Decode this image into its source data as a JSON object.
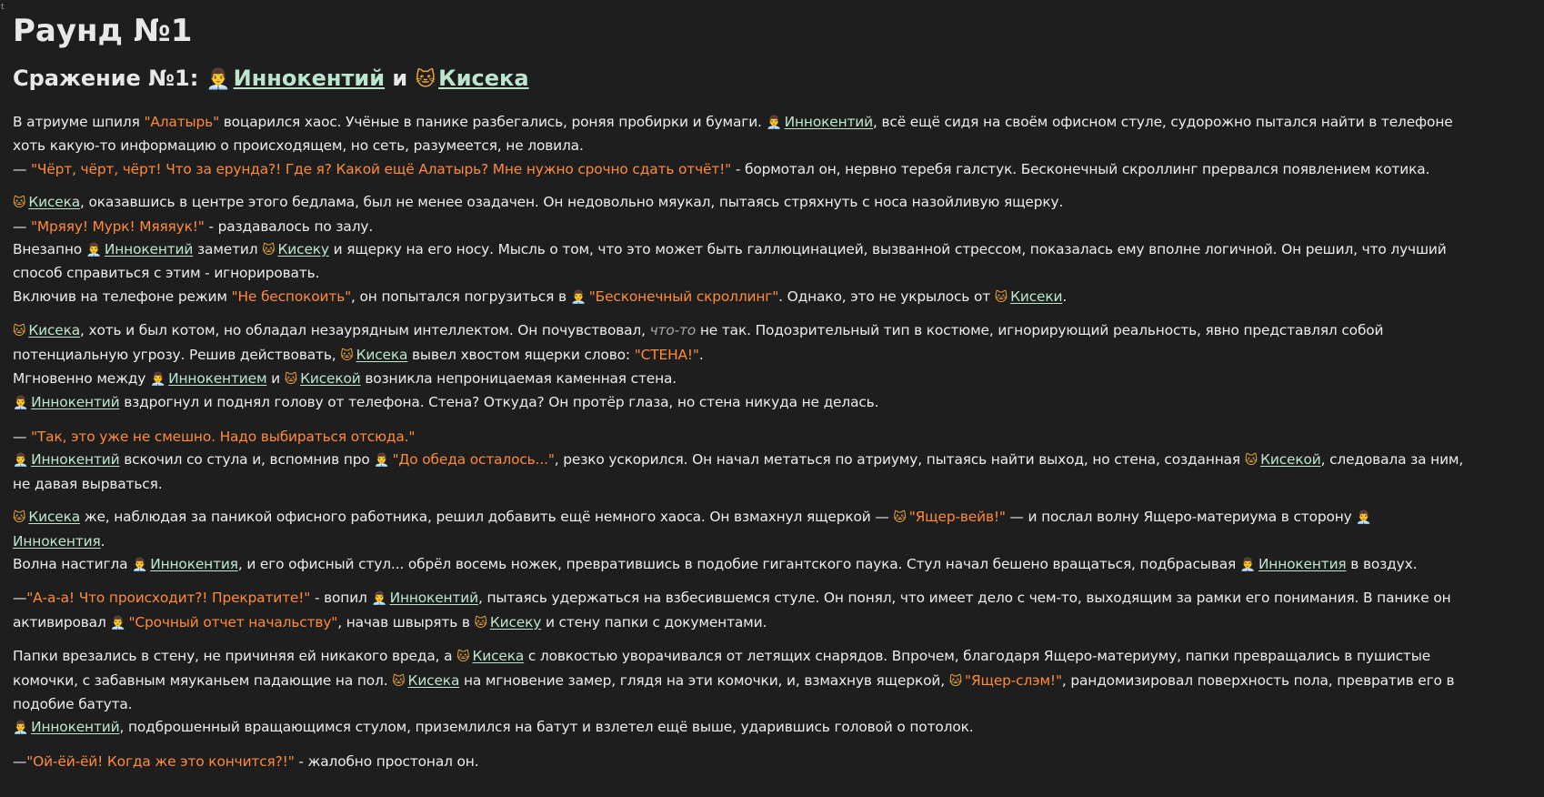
{
  "corner_mark": "t",
  "icons": {
    "cat": "🐱",
    "man": "👨‍💼"
  },
  "title": "Раунд №1",
  "battle": {
    "prefix": "Сражение №1: ",
    "fighter1": "Иннокентий",
    "and": " и ",
    "fighter2": "Кисека"
  },
  "paragraphs": [
    {
      "lines": [
        [
          {
            "t": "text",
            "v": "В атриуме шпиля "
          },
          {
            "t": "q",
            "v": "\"Алатырь\""
          },
          {
            "t": "text",
            "v": " воцарился хаос. Учёные в панике разбегались, роняя пробирки и бумаги. "
          },
          {
            "t": "man"
          },
          {
            "t": "link",
            "v": "Иннокентий"
          },
          {
            "t": "text",
            "v": ", всё ещё сидя на своём офисном стуле, судорожно пытался найти в телефоне"
          }
        ],
        [
          {
            "t": "text",
            "v": "хоть какую-то информацию о происходящем, но сеть, разумеется, не ловила."
          }
        ],
        [
          {
            "t": "text",
            "v": "— "
          },
          {
            "t": "q",
            "v": "\"Чёрт, чёрт, чёрт! Что за ерунда?! Где я? Какой ещё Алатырь? Мне нужно срочно сдать отчёт!\""
          },
          {
            "t": "text",
            "v": " - бормотал он, нервно теребя галстук. Бесконечный скроллинг прервался появлением котика."
          }
        ]
      ]
    },
    {
      "lines": [
        [
          {
            "t": "cat"
          },
          {
            "t": "link",
            "v": "Кисека"
          },
          {
            "t": "text",
            "v": ", оказавшись в центре этого бедлама, был не менее озадачен. Он недовольно мяукал, пытаясь стряхнуть с носа назойливую ящерку."
          }
        ],
        [
          {
            "t": "text",
            "v": "— "
          },
          {
            "t": "q",
            "v": "\"Мряяу! Мурк! Мяяяук!\""
          },
          {
            "t": "text",
            "v": " - раздавалось по залу."
          }
        ],
        [
          {
            "t": "text",
            "v": "Внезапно "
          },
          {
            "t": "man"
          },
          {
            "t": "link",
            "v": "Иннокентий"
          },
          {
            "t": "text",
            "v": " заметил "
          },
          {
            "t": "cat"
          },
          {
            "t": "link",
            "v": "Кисеку"
          },
          {
            "t": "text",
            "v": " и ящерку на его носу. Мысль о том, что это может быть галлюцинацией, вызванной стрессом, показалась ему вполне логичной. Он решил, что лучший"
          }
        ],
        [
          {
            "t": "text",
            "v": "способ справиться с этим - игнорировать."
          }
        ],
        [
          {
            "t": "text",
            "v": "Включив на телефоне режим "
          },
          {
            "t": "q",
            "v": "\"Не беспокоить\""
          },
          {
            "t": "text",
            "v": ", он попытался погрузиться в "
          },
          {
            "t": "man"
          },
          {
            "t": "q",
            "v": "\"Бесконечный скроллинг\""
          },
          {
            "t": "text",
            "v": ". Однако, это не укрылось от "
          },
          {
            "t": "cat"
          },
          {
            "t": "link",
            "v": "Кисеки"
          },
          {
            "t": "text",
            "v": "."
          }
        ]
      ]
    },
    {
      "lines": [
        [
          {
            "t": "cat"
          },
          {
            "t": "link",
            "v": "Кисека"
          },
          {
            "t": "text",
            "v": ", хоть и был котом, но обладал незаурядным интеллектом. Он почувствовал, "
          },
          {
            "t": "em",
            "v": "что-то"
          },
          {
            "t": "text",
            "v": " не так. Подозрительный тип в костюме, игнорирующий реальность, явно представлял собой"
          }
        ],
        [
          {
            "t": "text",
            "v": "потенциальную угрозу. Решив действовать, "
          },
          {
            "t": "cat"
          },
          {
            "t": "link",
            "v": "Кисека"
          },
          {
            "t": "text",
            "v": " вывел хвостом ящерки слово: "
          },
          {
            "t": "q",
            "v": "\"СТЕНА!\""
          },
          {
            "t": "text",
            "v": "."
          }
        ],
        [
          {
            "t": "text",
            "v": "Мгновенно между "
          },
          {
            "t": "man"
          },
          {
            "t": "link",
            "v": "Иннокентием"
          },
          {
            "t": "text",
            "v": " и "
          },
          {
            "t": "cat"
          },
          {
            "t": "link",
            "v": "Кисекой"
          },
          {
            "t": "text",
            "v": " возникла непроницаемая каменная стена."
          }
        ],
        [
          {
            "t": "man"
          },
          {
            "t": "link",
            "v": "Иннокентий"
          },
          {
            "t": "text",
            "v": " вздрогнул и поднял голову от телефона. Стена? Откуда? Он протёр глаза, но стена никуда не делась."
          }
        ]
      ]
    },
    {
      "lines": [
        [
          {
            "t": "text",
            "v": "— "
          },
          {
            "t": "q",
            "v": "\"Так, это уже не смешно. Надо выбираться отсюда.\""
          }
        ],
        [
          {
            "t": "man"
          },
          {
            "t": "link",
            "v": "Иннокентий"
          },
          {
            "t": "text",
            "v": " вскочил со стула и, вспомнив про "
          },
          {
            "t": "man"
          },
          {
            "t": "q",
            "v": "\"До обеда осталось...\""
          },
          {
            "t": "text",
            "v": ", резко ускорился. Он начал метаться по атриуму, пытаясь найти выход, но стена, созданная "
          },
          {
            "t": "cat"
          },
          {
            "t": "link",
            "v": "Кисекой"
          },
          {
            "t": "text",
            "v": ", следовала за ним,"
          }
        ],
        [
          {
            "t": "text",
            "v": "не давая вырваться."
          }
        ]
      ]
    },
    {
      "lines": [
        [
          {
            "t": "cat"
          },
          {
            "t": "link",
            "v": "Кисека"
          },
          {
            "t": "text",
            "v": " же, наблюдая за паникой офисного работника, решил добавить ещё немного хаоса. Он взмахнул ящеркой — "
          },
          {
            "t": "cat"
          },
          {
            "t": "q",
            "v": "\"Ящер-вейв!\""
          },
          {
            "t": "text",
            "v": " — и послал волну Ящеро-материума в сторону "
          },
          {
            "t": "man"
          }
        ],
        [
          {
            "t": "link",
            "v": "Иннокентия"
          },
          {
            "t": "text",
            "v": "."
          }
        ],
        [
          {
            "t": "text",
            "v": "Волна настигла "
          },
          {
            "t": "man"
          },
          {
            "t": "link",
            "v": "Иннокентия"
          },
          {
            "t": "text",
            "v": ", и его офисный стул... обрёл восемь ножек, превратившись в подобие гигантского паука. Стул начал бешено вращаться, подбрасывая "
          },
          {
            "t": "man"
          },
          {
            "t": "link",
            "v": "Иннокентия"
          },
          {
            "t": "text",
            "v": " в воздух."
          }
        ]
      ]
    },
    {
      "lines": [
        [
          {
            "t": "text",
            "v": "—"
          },
          {
            "t": "q",
            "v": "\"А-а-а! Что происходит?! Прекратите!\""
          },
          {
            "t": "text",
            "v": " - вопил "
          },
          {
            "t": "man"
          },
          {
            "t": "link",
            "v": "Иннокентий"
          },
          {
            "t": "text",
            "v": ", пытаясь удержаться на взбесившемся стуле. Он понял, что имеет дело с чем-то, выходящим за рамки его понимания. В панике он"
          }
        ],
        [
          {
            "t": "text",
            "v": "активировал "
          },
          {
            "t": "man"
          },
          {
            "t": "q",
            "v": "\"Срочный отчет начальству\""
          },
          {
            "t": "text",
            "v": ", начав швырять в "
          },
          {
            "t": "cat"
          },
          {
            "t": "link",
            "v": "Кисеку"
          },
          {
            "t": "text",
            "v": " и стену папки с документами."
          }
        ]
      ]
    },
    {
      "lines": [
        [
          {
            "t": "text",
            "v": "Папки врезались в стену, не причиняя ей никакого вреда, а "
          },
          {
            "t": "cat"
          },
          {
            "t": "link",
            "v": "Кисека"
          },
          {
            "t": "text",
            "v": " с ловкостью уворачивался от летящих снарядов. Впрочем, благодаря Ящеро-материуму, папки превращались в пушистые"
          }
        ],
        [
          {
            "t": "text",
            "v": "комочки, с забавным мяуканьем падающие на пол. "
          },
          {
            "t": "cat"
          },
          {
            "t": "link",
            "v": "Кисека"
          },
          {
            "t": "text",
            "v": " на мгновение замер, глядя на эти комочки, и, взмахнув ящеркой, "
          },
          {
            "t": "cat"
          },
          {
            "t": "q",
            "v": "\"Ящер-слэм!\""
          },
          {
            "t": "text",
            "v": ", рандомизировал поверхность пола, превратив его в"
          }
        ],
        [
          {
            "t": "text",
            "v": "подобие батута."
          }
        ],
        [
          {
            "t": "man"
          },
          {
            "t": "link",
            "v": "Иннокентий"
          },
          {
            "t": "text",
            "v": ", подброшенный вращающимся стулом, приземлился на батут и взлетел ещё выше, ударившись головой о потолок."
          }
        ]
      ]
    },
    {
      "lines": [
        [
          {
            "t": "text",
            "v": "—"
          },
          {
            "t": "q",
            "v": "\"Ой-ёй-ёй! Когда же это кончится?!\""
          },
          {
            "t": "text",
            "v": " - жалобно простонал он."
          }
        ]
      ]
    }
  ]
}
